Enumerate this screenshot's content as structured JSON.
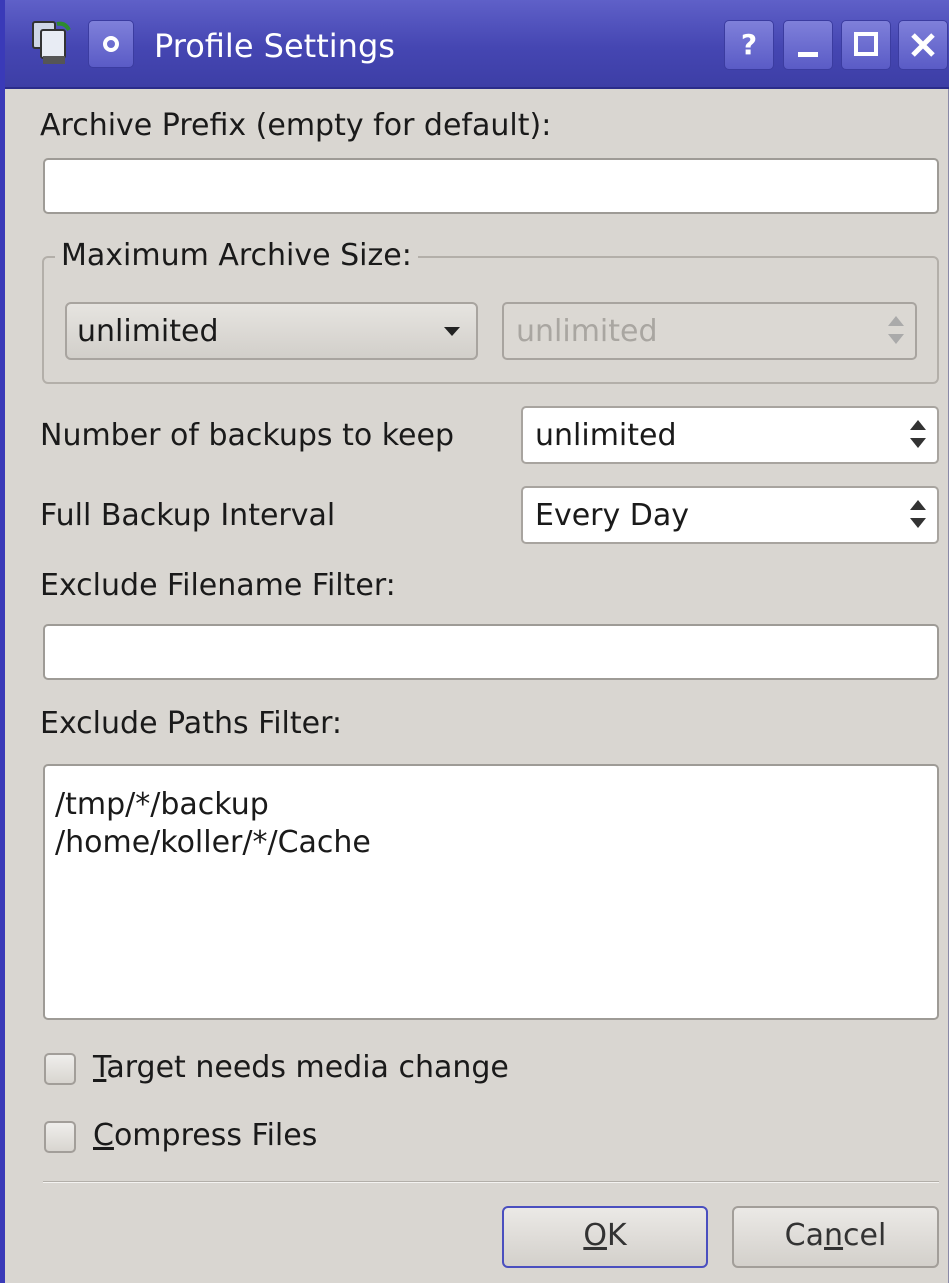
{
  "window": {
    "title": "Profile Settings",
    "help_label": "?",
    "minimize_label": "_",
    "maximize_label": "□",
    "close_label": "✕",
    "accent": "#4546b2"
  },
  "archive_prefix": {
    "label": "Archive Prefix (empty for default):",
    "value": ""
  },
  "max_archive_size": {
    "group_label": "Maximum Archive Size:",
    "combo_value": "unlimited",
    "spin_value": "unlimited",
    "spin_enabled": false
  },
  "backups_to_keep": {
    "label": "Number of backups to keep",
    "value": "unlimited"
  },
  "full_backup_interval": {
    "label": "Full Backup Interval",
    "value": "Every Day"
  },
  "exclude_filename": {
    "label": "Exclude Filename Filter:",
    "value": ""
  },
  "exclude_paths": {
    "label": "Exclude Paths Filter:",
    "lines": [
      "/tmp/*/backup",
      "/home/koller/*/Cache"
    ]
  },
  "checkboxes": [
    {
      "mnemonic": "T",
      "rest": "arget needs media change",
      "checked": false
    },
    {
      "mnemonic": "C",
      "rest": "ompress Files",
      "checked": false
    }
  ],
  "buttons": {
    "ok": {
      "mnemonic": "O",
      "rest": "K"
    },
    "cancel": {
      "before": "Ca",
      "mnemonic": "n",
      "after": "cel"
    }
  }
}
